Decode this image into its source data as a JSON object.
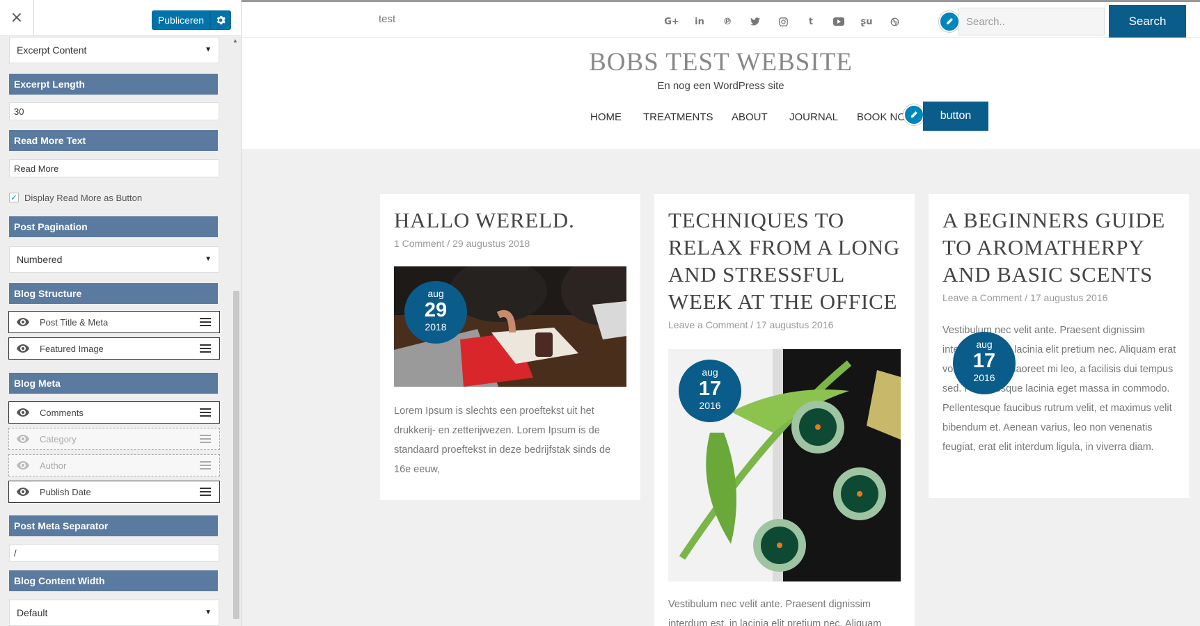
{
  "sidebar": {
    "close_icon": "×",
    "publish_label": "Publiceren",
    "settings_icon": "gear-icon",
    "excerpt_select": "Excerpt Content",
    "excerpt_length_heading": "Excerpt Length",
    "excerpt_length_value": "30",
    "read_more_heading": "Read More Text",
    "read_more_value": "Read More",
    "display_button_checked": true,
    "display_button_label": "Display Read More as Button",
    "pagination_heading": "Post Pagination",
    "pagination_value": "Numbered",
    "structure_heading": "Blog Structure",
    "structure_items": [
      {
        "label": "Post Title & Meta",
        "visible": true
      },
      {
        "label": "Featured Image",
        "visible": true
      }
    ],
    "meta_heading": "Blog Meta",
    "meta_items": [
      {
        "label": "Comments",
        "visible": true
      },
      {
        "label": "Category",
        "visible": false
      },
      {
        "label": "Author",
        "visible": false
      },
      {
        "label": "Publish Date",
        "visible": true
      }
    ],
    "separator_heading": "Post Meta Separator",
    "separator_value": "/",
    "content_width_heading": "Blog Content Width",
    "content_width_value": "Default"
  },
  "topbar": {
    "text": "test",
    "social_icons": [
      "google-plus-icon",
      "linkedin-icon",
      "pinterest-icon",
      "twitter-icon",
      "instagram-icon",
      "tumblr-icon",
      "youtube-icon",
      "stumbleupon-icon",
      "dribbble-icon"
    ],
    "search_placeholder": "Search..",
    "search_button": "Search"
  },
  "header": {
    "title": "BOBS TEST WEBSITE",
    "tagline": "En nog een WordPress site",
    "nav": [
      "HOME",
      "TREATMENTS",
      "ABOUT",
      "JOURNAL",
      "BOOK NO"
    ],
    "nav_button": "button"
  },
  "posts": [
    {
      "title": "HALLO WERELD.",
      "meta_comments": "1 Comment",
      "meta_separator": "/",
      "meta_date": "29 augustus 2018",
      "badge_month": "aug",
      "badge_day": "29",
      "badge_year": "2018",
      "excerpt": "Lorem Ipsum is slechts een proeftekst uit het drukkerij- en zetterijwezen. Lorem Ipsum is de standaard proeftekst in deze bedrijfstak sinds de 16e eeuw,"
    },
    {
      "title": "TECHNIQUES TO RELAX FROM A LONG AND STRESSFUL WEEK AT THE OFFICE",
      "meta_comments": "Leave a Comment",
      "meta_separator": "/",
      "meta_date": "17 augustus 2016",
      "badge_month": "aug",
      "badge_day": "17",
      "badge_year": "2016",
      "excerpt": "Vestibulum nec velit ante. Praesent dignissim interdum est, in lacinia elit pretium nec. Aliquam"
    },
    {
      "title": "A BEGINNERS GUIDE TO AROMATHERPY AND BASIC SCENTS",
      "meta_comments": "Leave a Comment",
      "meta_separator": "/",
      "meta_date": "17 augustus 2016",
      "badge_month": "aug",
      "badge_day": "17",
      "badge_year": "2016",
      "excerpt": "Vestibulum nec velit ante. Praesent dignissim interdum est, in lacinia elit pretium nec. Aliquam erat volutpat. Fusce laoreet mi leo, a facilisis dui tempus sed. Pellentesque lacinia eget massa in commodo. Pellentesque faucibus rutrum velit, et maximus velit bibendum et. Aenean varius, leo non venenatis feugiat, erat elit interdum ligula, in viverra diam."
    }
  ],
  "colors": {
    "accent": "#0a5d8a",
    "panel_heading": "#5b7aa0",
    "wp_blue": "#0073aa"
  }
}
